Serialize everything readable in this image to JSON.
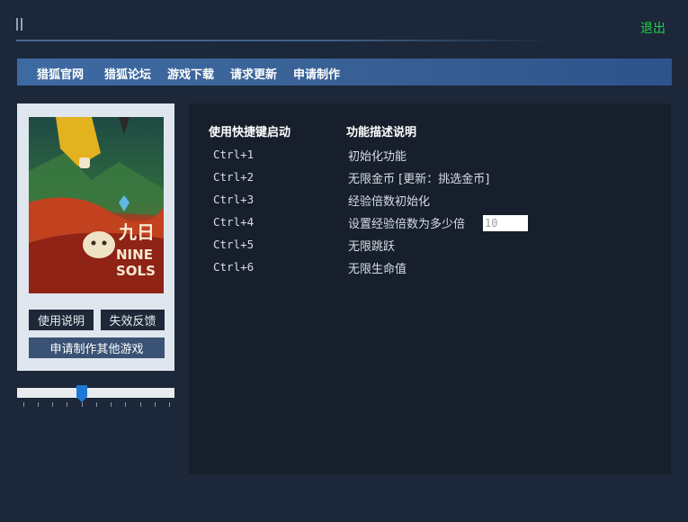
{
  "header": {
    "exit_label": "退出"
  },
  "nav": {
    "items": [
      "猎狐官网",
      "猎狐论坛",
      "游戏下载",
      "请求更新",
      "申请制作"
    ]
  },
  "game": {
    "cover_title_cn": "九日",
    "cover_title_en_1": "NINE",
    "cover_title_en_2": "SOLS"
  },
  "buttons": {
    "instructions": "使用说明",
    "feedback": "失效反馈",
    "request_other": "申请制作其他游戏"
  },
  "slider": {
    "value_fraction": 0.41
  },
  "table": {
    "header_hotkey": "使用快捷键启动",
    "header_desc": "功能描述说明",
    "rows": [
      {
        "hotkey": "Ctrl+1",
        "desc": "初始化功能"
      },
      {
        "hotkey": "Ctrl+2",
        "desc": "无限金币 [更新：挑选金币]"
      },
      {
        "hotkey": "Ctrl+3",
        "desc": "经验倍数初始化"
      },
      {
        "hotkey": "Ctrl+4",
        "desc": "设置经验倍数为多少倍"
      },
      {
        "hotkey": "Ctrl+5",
        "desc": "无限跳跃"
      },
      {
        "hotkey": "Ctrl+6",
        "desc": "无限生命值"
      }
    ],
    "multiplier_value": "10"
  }
}
